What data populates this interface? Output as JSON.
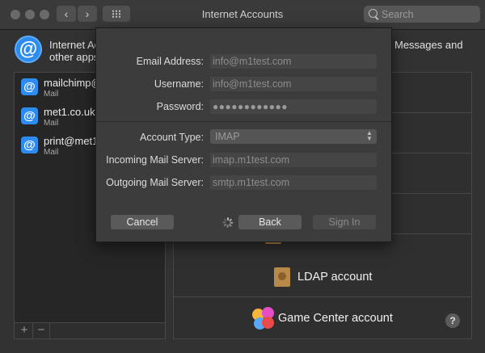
{
  "window": {
    "title": "Internet Accounts"
  },
  "search": {
    "placeholder": "Search"
  },
  "nav": {
    "back": "‹",
    "forward": "›"
  },
  "header": {
    "line1_left": "Internet Ac",
    "line2_left": "other apps",
    "line1_right": "Messages and"
  },
  "accounts": [
    {
      "name": "mailchimp@",
      "type": "Mail"
    },
    {
      "name": "met1.co.uk",
      "type": "Mail"
    },
    {
      "name": "print@met1.",
      "type": "Mail"
    }
  ],
  "list_buttons": {
    "add": "+",
    "remove": "−"
  },
  "providers": {
    "ldap": "LDAP account",
    "game_center": "Game Center account"
  },
  "help": "?",
  "dialog": {
    "email_label": "Email Address:",
    "email_value": "info@m1test.com",
    "username_label": "Username:",
    "username_value": "info@m1test.com",
    "password_label": "Password:",
    "password_value": "●●●●●●●●●●●●",
    "account_type_label": "Account Type:",
    "account_type_value": "IMAP",
    "incoming_label": "Incoming Mail Server:",
    "incoming_value": "imap.m1test.com",
    "outgoing_label": "Outgoing Mail Server:",
    "outgoing_value": "smtp.m1test.com",
    "cancel": "Cancel",
    "back": "Back",
    "sign_in": "Sign In"
  },
  "colors": {
    "accent": "#2c8cf0",
    "background": "#323232",
    "sheet": "#3c3c3c"
  }
}
